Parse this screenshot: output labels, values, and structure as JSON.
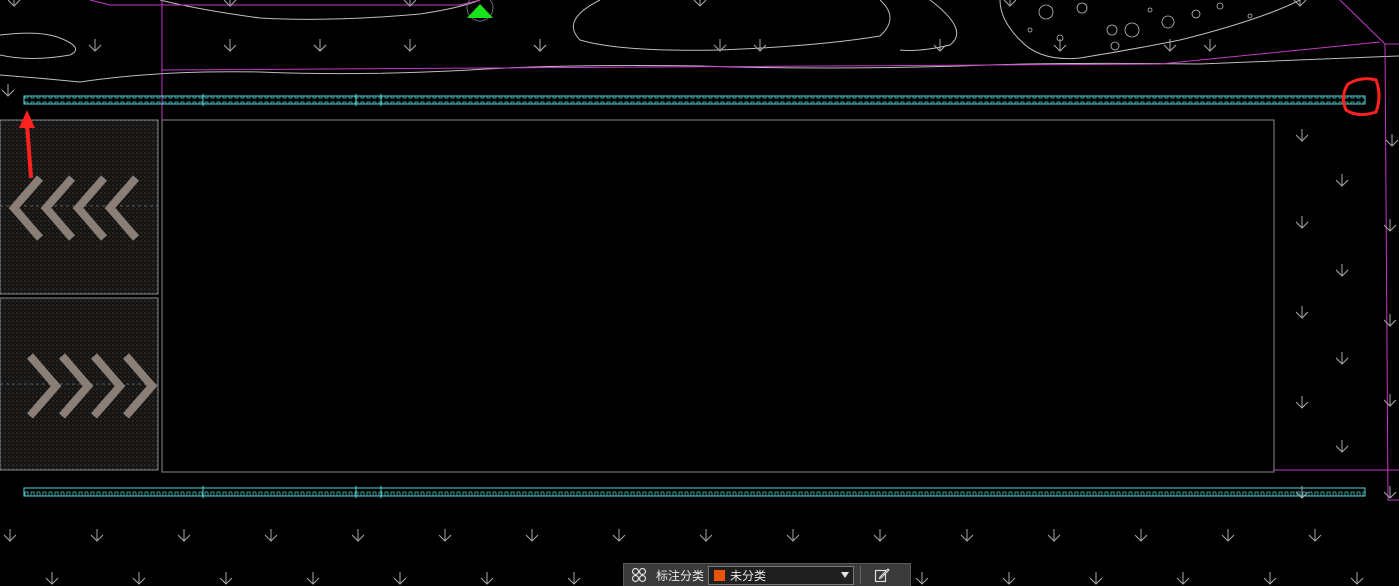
{
  "toolbar": {
    "grid_icon": "four-circles-icon",
    "label": "标注分类",
    "selected_category": "未分类",
    "selected_color": "#e8550a",
    "edit_icon": "edit-icon"
  },
  "annotations": {
    "arrow_color": "#ff2020",
    "circle_color": "#ff2020"
  }
}
